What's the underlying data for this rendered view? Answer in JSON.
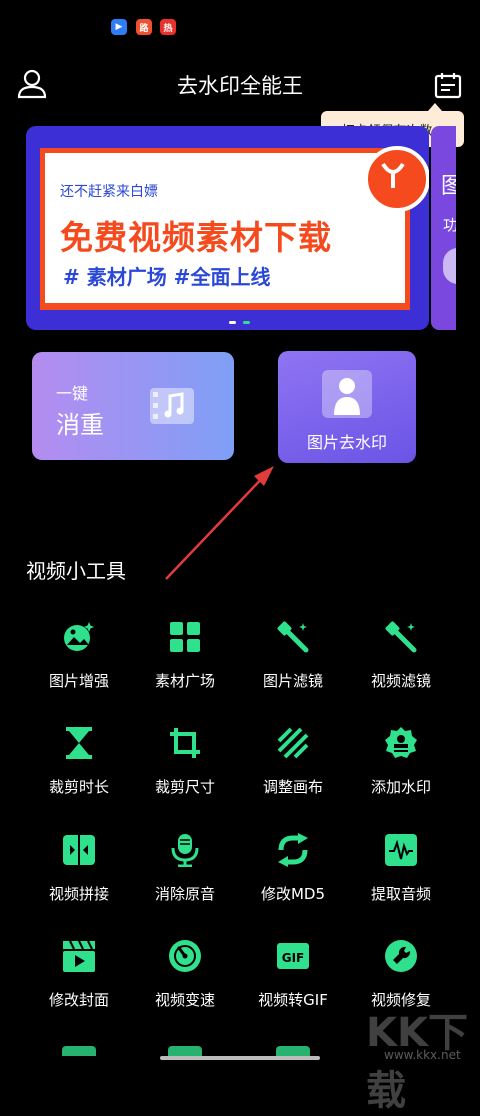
{
  "header": {
    "title": "去水印全能王",
    "tooltip": "打卡领保存次数~"
  },
  "status_icons": [
    {
      "name": "app-icon-1",
      "color": "#2f7cf6",
      "glyph": "▶"
    },
    {
      "name": "app-icon-2",
      "color": "#f0502f",
      "glyph": "路"
    },
    {
      "name": "app-icon-3",
      "color": "#e8312c",
      "glyph": "热"
    }
  ],
  "banner": {
    "small_text": "还不赶紧来白嫖",
    "big_text": "免费视频素材下载",
    "tags_text": "# 素材广场 #全面上线",
    "peek_chars": [
      "图",
      "功"
    ]
  },
  "features": {
    "dedupe_line1": "一键",
    "dedupe_line2": "消重",
    "remove_watermark": "图片去水印"
  },
  "section_title": "视频小工具",
  "tools": [
    {
      "label": "图片增强",
      "icon": "image-enhance-icon"
    },
    {
      "label": "素材广场",
      "icon": "grid-icon"
    },
    {
      "label": "图片滤镜",
      "icon": "magic-wand-icon"
    },
    {
      "label": "视频滤镜",
      "icon": "magic-wand-icon"
    },
    {
      "label": "裁剪时长",
      "icon": "hourglass-icon"
    },
    {
      "label": "裁剪尺寸",
      "icon": "crop-icon"
    },
    {
      "label": "调整画布",
      "icon": "stripes-icon"
    },
    {
      "label": "添加水印",
      "icon": "badge-icon"
    },
    {
      "label": "视频拼接",
      "icon": "join-icon"
    },
    {
      "label": "消除原音",
      "icon": "microphone-icon"
    },
    {
      "label": "修改MD5",
      "icon": "refresh-icon"
    },
    {
      "label": "提取音频",
      "icon": "waveform-icon"
    },
    {
      "label": "修改封面",
      "icon": "clapper-icon"
    },
    {
      "label": "视频变速",
      "icon": "speedometer-icon"
    },
    {
      "label": "视频转GIF",
      "icon": "gif-icon"
    },
    {
      "label": "视频修复",
      "icon": "wrench-icon"
    }
  ],
  "watermark_text": "KK下载",
  "watermark_url": "www.kkx.net",
  "colors": {
    "accent": "#2fe08c",
    "background": "#000000",
    "banner_blue": "#3d2fd6",
    "banner_orange": "#f44a1e"
  }
}
